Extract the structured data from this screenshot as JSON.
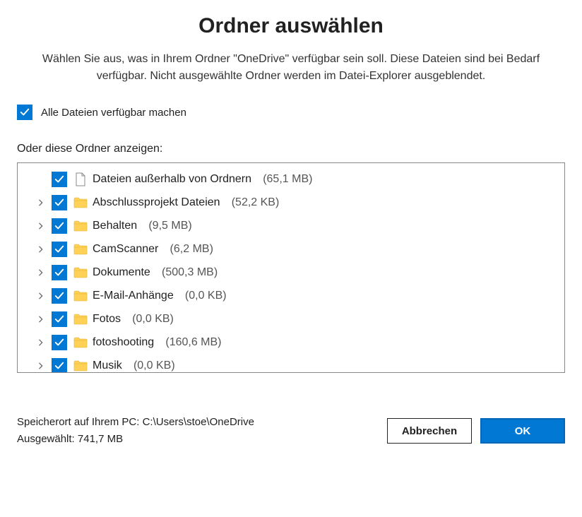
{
  "title": "Ordner auswählen",
  "subtitle": "Wählen Sie aus, was in Ihrem Ordner \"OneDrive\" verfügbar sein soll. Diese Dateien sind bei Bedarf verfügbar. Nicht ausgewählte Ordner werden im Datei-Explorer ausgeblendet.",
  "allFiles": {
    "checked": true,
    "label": "Alle Dateien verfügbar machen"
  },
  "sectionLabel": "Oder diese Ordner anzeigen:",
  "items": [
    {
      "expandable": false,
      "checked": true,
      "icon": "file",
      "name": "Dateien außerhalb von Ordnern",
      "size": "(65,1 MB)"
    },
    {
      "expandable": true,
      "checked": true,
      "icon": "folder",
      "name": "Abschlussprojekt Dateien",
      "size": "(52,2 KB)"
    },
    {
      "expandable": true,
      "checked": true,
      "icon": "folder",
      "name": "Behalten",
      "size": "(9,5 MB)"
    },
    {
      "expandable": true,
      "checked": true,
      "icon": "folder",
      "name": "CamScanner",
      "size": "(6,2 MB)"
    },
    {
      "expandable": true,
      "checked": true,
      "icon": "folder",
      "name": "Dokumente",
      "size": "(500,3 MB)"
    },
    {
      "expandable": true,
      "checked": true,
      "icon": "folder",
      "name": "E-Mail-Anhänge",
      "size": "(0,0 KB)"
    },
    {
      "expandable": true,
      "checked": true,
      "icon": "folder",
      "name": "Fotos",
      "size": "(0,0 KB)"
    },
    {
      "expandable": true,
      "checked": true,
      "icon": "folder",
      "name": "fotoshooting",
      "size": "(160,6 MB)"
    },
    {
      "expandable": true,
      "checked": true,
      "icon": "folder",
      "name": "Musik",
      "size": "(0,0 KB)"
    }
  ],
  "footer": {
    "location": "Speicherort auf Ihrem PC: C:\\Users\\stoe\\OneDrive",
    "selected": "Ausgewählt: 741,7 MB"
  },
  "buttons": {
    "cancel": "Abbrechen",
    "ok": "OK"
  },
  "colors": {
    "accent": "#0078d4"
  }
}
